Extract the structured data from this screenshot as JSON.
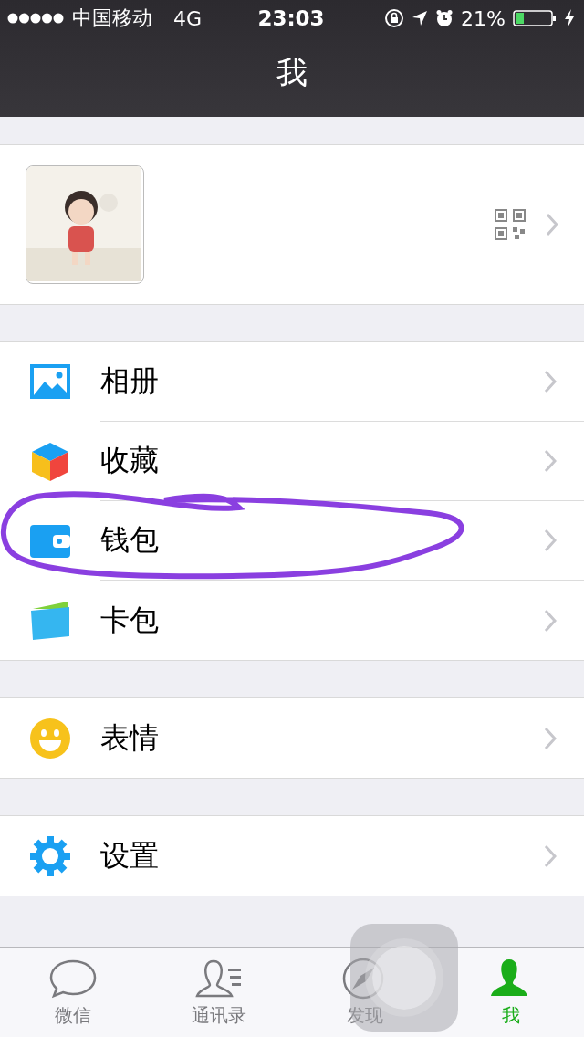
{
  "status_bar": {
    "carrier": "中国移动",
    "network": "4G",
    "time": "23:03",
    "battery": "21%"
  },
  "nav": {
    "title": "我"
  },
  "groups": [
    [
      {
        "kind": "album",
        "label": "相册"
      },
      {
        "kind": "favorites",
        "label": "收藏"
      },
      {
        "kind": "wallet",
        "label": "钱包"
      },
      {
        "kind": "cards",
        "label": "卡包"
      }
    ],
    [
      {
        "kind": "stickers",
        "label": "表情"
      }
    ],
    [
      {
        "kind": "settings",
        "label": "设置"
      }
    ]
  ],
  "tabs": [
    {
      "kind": "chats",
      "label": "微信",
      "selected": false
    },
    {
      "kind": "contacts",
      "label": "通讯录",
      "selected": false
    },
    {
      "kind": "discover",
      "label": "发现",
      "selected": false
    },
    {
      "kind": "me",
      "label": "我",
      "selected": true
    }
  ]
}
